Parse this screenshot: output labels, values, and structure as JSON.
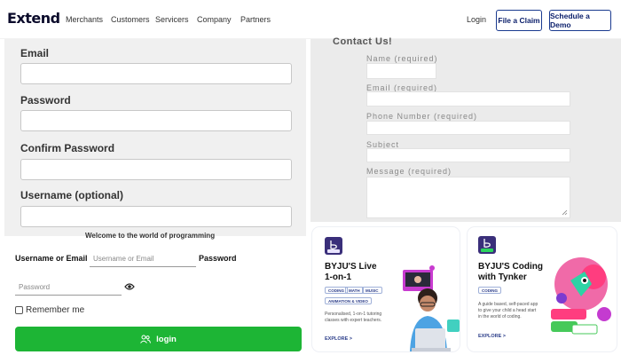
{
  "header": {
    "logo": "Extend",
    "nav": [
      "Merchants",
      "Customers",
      "Servicers",
      "Company",
      "Partners"
    ],
    "login": "Login",
    "file_claim": "File a Claim",
    "schedule_demo": "Schedule a Demo"
  },
  "register": {
    "email_label": "Email",
    "password_label": "Password",
    "confirm_label": "Confirm Password",
    "username_label": "Username (optional)"
  },
  "login": {
    "welcome": "Welcome to the world of programming",
    "username_label": "Username or Email",
    "username_placeholder": "Username or Email",
    "password_label": "Password",
    "password_placeholder": "Password",
    "remember": "Remember me",
    "button": "login"
  },
  "contact": {
    "title": "Contact Us!",
    "name_label": "Name (required)",
    "email_label": "Email (required)",
    "phone_label": "Phone Number (required)",
    "subject_label": "Subject",
    "message_label": "Message (required)"
  },
  "cards": [
    {
      "title_line1": "BYJU'S Live",
      "title_line2": "1-on-1",
      "tags": [
        "CODING",
        "MATH",
        "MUSIC",
        "ANIMATION & VIDEO"
      ],
      "desc_line1": "Personalised, 1-on-1 tutoring",
      "desc_line2": "classes with expert teachers.",
      "explore": "EXPLORE >"
    },
    {
      "title_line1": "BYJU'S Coding",
      "title_line2": "with Tynker",
      "tags": [
        "CODING"
      ],
      "desc_line1": "A guide based, self-paced app",
      "desc_line2": "to give your child a head start",
      "desc_line3": "in the world of coding.",
      "explore": "EXPLORE >"
    }
  ],
  "colors": {
    "brand_navy": "#0b1f6b",
    "login_green": "#1db535",
    "byjus_purple": "#3a2f7a"
  }
}
